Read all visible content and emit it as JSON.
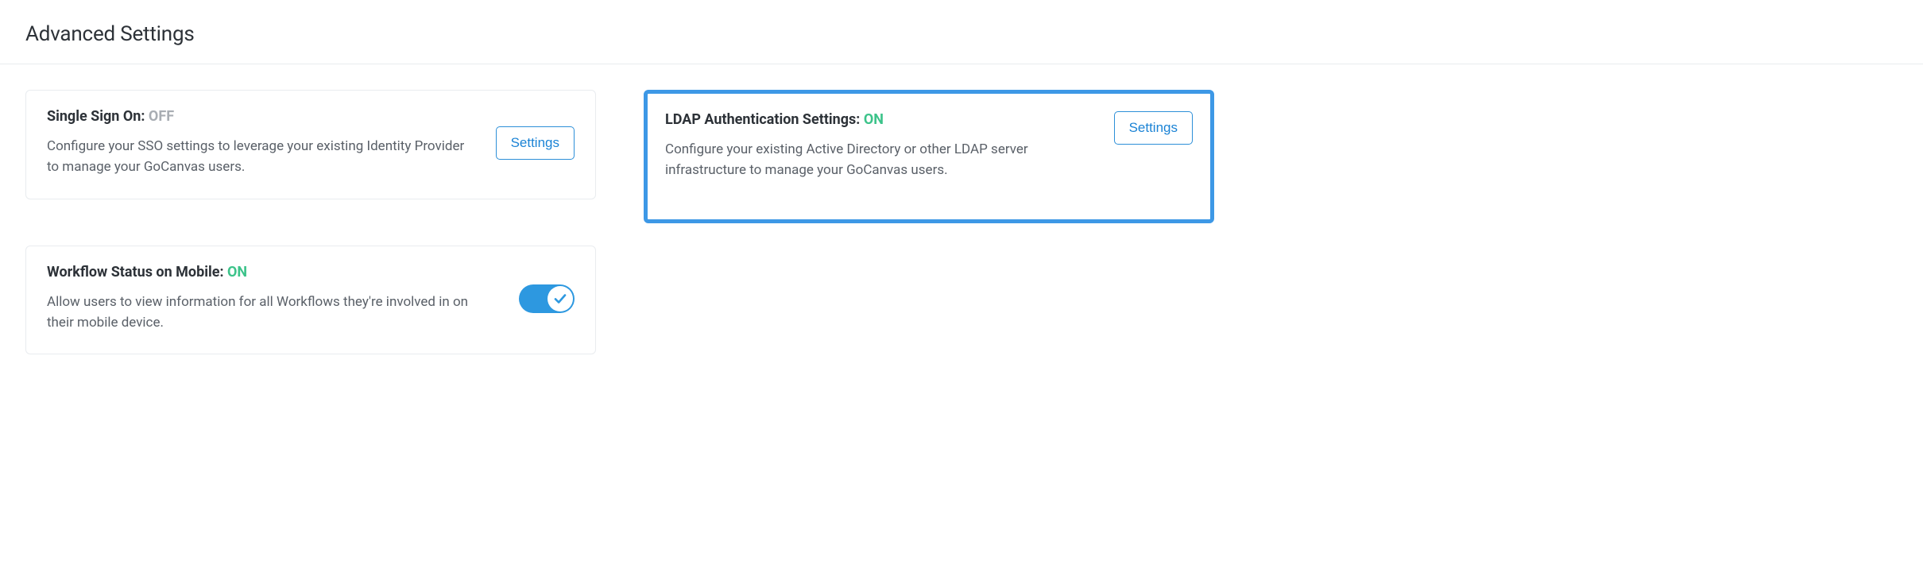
{
  "page": {
    "title": "Advanced Settings"
  },
  "cards": {
    "sso": {
      "title_prefix": "Single Sign On: ",
      "status_label": "OFF",
      "status_on": false,
      "description": "Configure your SSO settings to leverage your existing Identity Provider to manage your GoCanvas users.",
      "button_label": "Settings"
    },
    "ldap": {
      "title_prefix": "LDAP Authentication Settings: ",
      "status_label": "ON",
      "status_on": true,
      "description": "Configure your existing Active Directory or other LDAP server infrastructure to manage your GoCanvas users.",
      "button_label": "Settings",
      "highlighted": true
    },
    "workflow": {
      "title_prefix": "Workflow Status on Mobile: ",
      "status_label": "ON",
      "status_on": true,
      "description": "Allow users to view information for all Workflows they're involved in on their mobile device.",
      "toggle_on": true
    }
  }
}
